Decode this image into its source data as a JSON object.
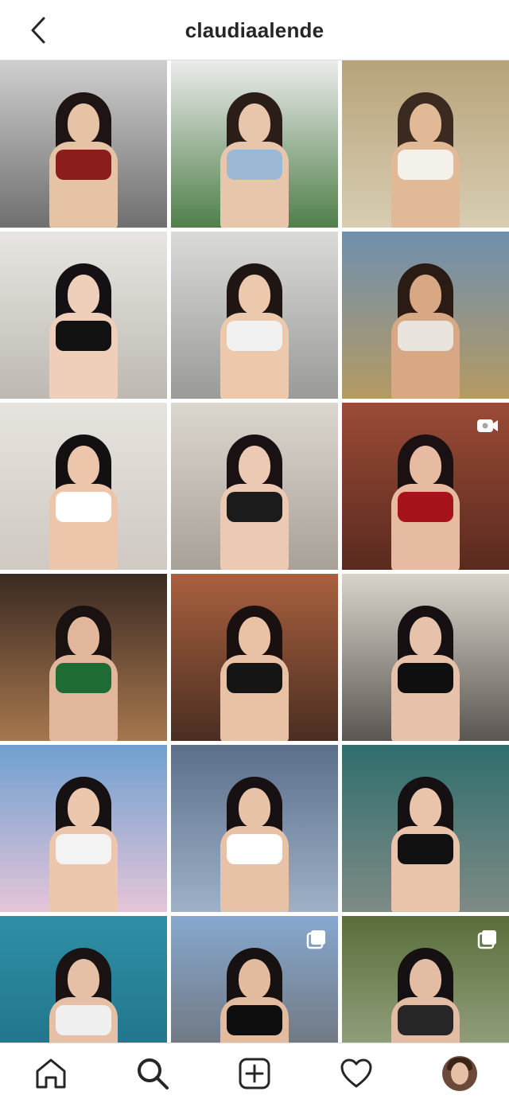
{
  "header": {
    "title": "claudiaalende",
    "back_icon": "chevron-left-icon"
  },
  "grid": {
    "tiles": [
      {
        "bg": "#cfcfcf",
        "bg2": "#6f6f6f",
        "skin": "#e7c3a6",
        "hair": "#1e1413",
        "top": "#8b1d1d",
        "badge": ""
      },
      {
        "bg": "#ececec",
        "bg2": "#4f7f4a",
        "skin": "#e8c6ac",
        "hair": "#2b1e18",
        "top": "#9bb8d4",
        "badge": ""
      },
      {
        "bg": "#b7a37a",
        "bg2": "#d8cdb2",
        "skin": "#e1b996",
        "hair": "#3a2a1f",
        "top": "#f4f1ea",
        "badge": ""
      },
      {
        "bg": "#e8e6e2",
        "bg2": "#bdb9b1",
        "skin": "#efcfb9",
        "hair": "#151014",
        "top": "#121212",
        "badge": ""
      },
      {
        "bg": "#dadad8",
        "bg2": "#9a9a98",
        "skin": "#ecc8ad",
        "hair": "#1f1614",
        "top": "#f1f1f1",
        "badge": ""
      },
      {
        "bg": "#6f8fae",
        "bg2": "#b59a63",
        "skin": "#d8a885",
        "hair": "#2a1b14",
        "top": "#e9e4de",
        "badge": ""
      },
      {
        "bg": "#e7e3de",
        "bg2": "#cfc9c2",
        "skin": "#ecc5aa",
        "hair": "#141012",
        "top": "#ffffff",
        "badge": ""
      },
      {
        "bg": "#dcd7cf",
        "bg2": "#a8a198",
        "skin": "#ecc9b2",
        "hair": "#1a1212",
        "top": "#1b1b1b",
        "badge": ""
      },
      {
        "bg": "#9a4b35",
        "bg2": "#5a2a1f",
        "skin": "#e6bba2",
        "hair": "#1b1112",
        "top": "#a7131c",
        "badge": "video-camera-icon"
      },
      {
        "bg": "#3b2a22",
        "bg2": "#a6774e",
        "skin": "#e2b69a",
        "hair": "#1a1111",
        "top": "#1f6b34",
        "badge": ""
      },
      {
        "bg": "#a9603e",
        "bg2": "#4a2e22",
        "skin": "#e9c2a6",
        "hair": "#1a1010",
        "top": "#151515",
        "badge": ""
      },
      {
        "bg": "#d9d4ca",
        "bg2": "#5b5652",
        "skin": "#e6c2aa",
        "hair": "#161012",
        "top": "#0f0f0f",
        "badge": ""
      },
      {
        "bg": "#6f9fd0",
        "bg2": "#e5c5d8",
        "skin": "#ecc6ad",
        "hair": "#161112",
        "top": "#f3f3f3",
        "badge": ""
      },
      {
        "bg": "#5b6f8b",
        "bg2": "#9fb1c7",
        "skin": "#e8c2a7",
        "hair": "#171113",
        "top": "#ffffff",
        "badge": ""
      },
      {
        "bg": "#2f6e6d",
        "bg2": "#7e8b86",
        "skin": "#e9c3aa",
        "hair": "#151012",
        "top": "#111111",
        "badge": ""
      },
      {
        "bg": "#2e8fa6",
        "bg2": "#1d6f83",
        "skin": "#e6c0a6",
        "hair": "#1a1213",
        "top": "#f0f0f0",
        "badge": ""
      },
      {
        "bg": "#87a8cf",
        "bg2": "#6a6b6c",
        "skin": "#e3bb9f",
        "hair": "#181112",
        "top": "#0e0e0e",
        "badge": "carousel-icon"
      },
      {
        "bg": "#5a6e3b",
        "bg2": "#a0ad8d",
        "skin": "#e3bda3",
        "hair": "#151012",
        "top": "#262626",
        "badge": "carousel-icon"
      }
    ],
    "partial_row": [
      {
        "bg": "#d8d8d8"
      },
      {
        "bg": "#a66a39"
      },
      {
        "bg": "#4f6a3b"
      }
    ]
  },
  "bottom_nav": {
    "items": [
      {
        "name": "home-icon"
      },
      {
        "name": "search-icon"
      },
      {
        "name": "new-post-icon"
      },
      {
        "name": "heart-icon"
      },
      {
        "name": "profile-avatar"
      }
    ]
  },
  "colors": {
    "text": "#262626",
    "divider": "#dbdbdb",
    "background": "#ffffff"
  }
}
